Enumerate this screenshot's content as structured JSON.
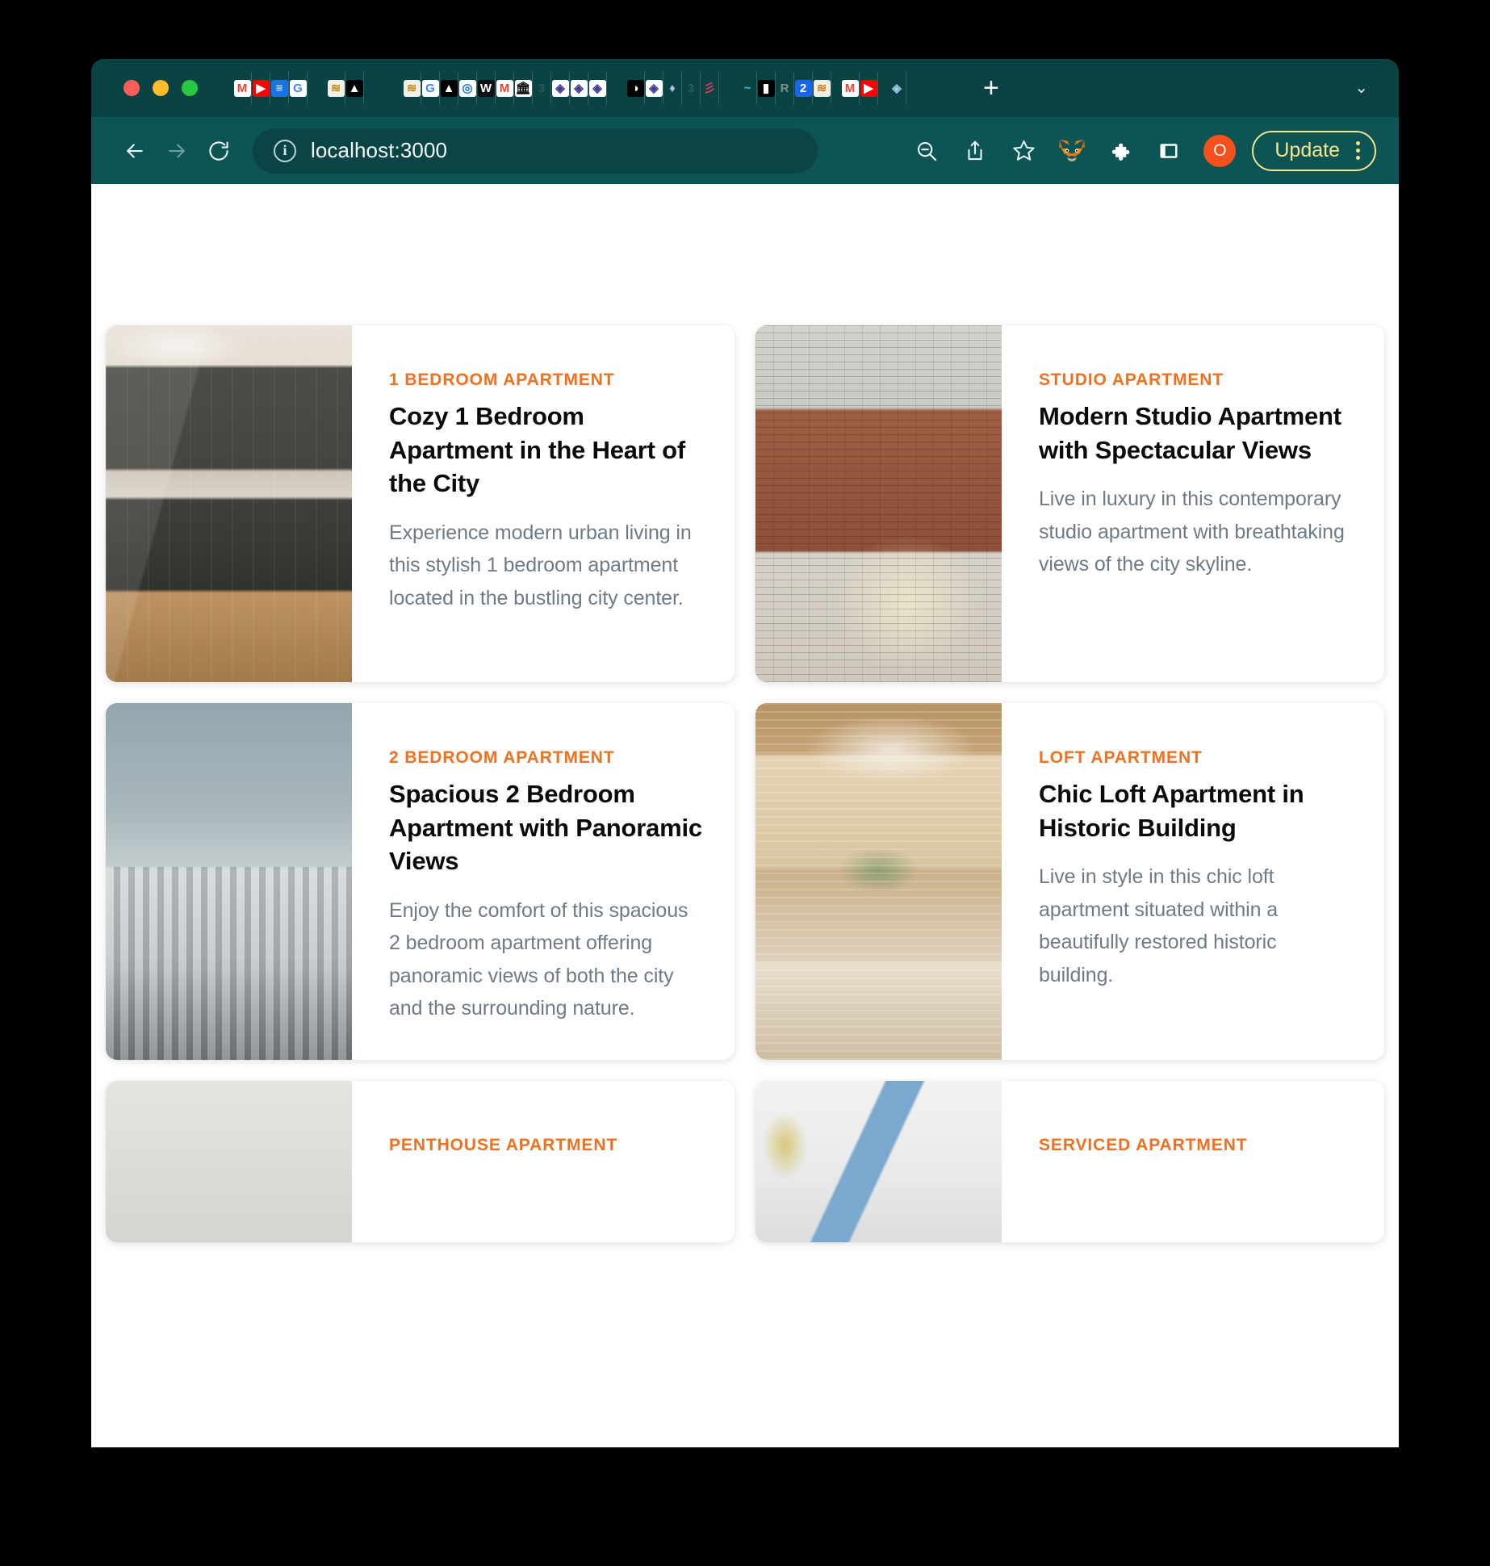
{
  "browser": {
    "traffic_lights": [
      "close",
      "minimize",
      "maximize"
    ],
    "new_tab_label": "+",
    "tab_list_chevron": "⌄",
    "nav": {
      "back_label": "←",
      "forward_label": "→",
      "reload_label": "⟳",
      "url": "localhost:3000",
      "info_glyph": "i"
    },
    "toolbar": {
      "zoom_out_icon": "zoom-out-icon",
      "share_icon": "share-icon",
      "bookmark_icon": "star-icon",
      "metamask_icon": "metamask-fox-icon",
      "extensions_icon": "puzzle-piece-icon",
      "sidebar_icon": "sidebar-panel-icon",
      "profile_initial": "O",
      "update_label": "Update",
      "menu_icon": "kebab-menu-icon"
    },
    "tabs": [
      {
        "name": "gmail",
        "glyph": "M"
      },
      {
        "name": "youtube",
        "glyph": "▶"
      },
      {
        "name": "google-docs",
        "glyph": "≡"
      },
      {
        "name": "google",
        "glyph": "G"
      },
      {
        "name": "blank-1",
        "glyph": ""
      },
      {
        "name": "blank-2",
        "glyph": ""
      },
      {
        "name": "sui",
        "glyph": "≋"
      },
      {
        "name": "vercel",
        "glyph": "▲"
      },
      {
        "name": "blank-3",
        "glyph": ""
      },
      {
        "name": "blank-4",
        "glyph": ""
      },
      {
        "name": "blank-5",
        "glyph": ""
      },
      {
        "name": "blank-6",
        "glyph": ""
      },
      {
        "name": "sui-2",
        "glyph": "≋"
      },
      {
        "name": "google-2",
        "glyph": "G"
      },
      {
        "name": "vercel-2",
        "glyph": "▲"
      },
      {
        "name": "chrome",
        "glyph": "◎"
      },
      {
        "name": "wikipedia",
        "glyph": "W"
      },
      {
        "name": "gmail-2",
        "glyph": "M"
      },
      {
        "name": "bank",
        "glyph": "🏛"
      },
      {
        "name": "web3-1",
        "glyph": "3"
      },
      {
        "name": "ethereum-1",
        "glyph": "◈"
      },
      {
        "name": "ethereum-2",
        "glyph": "◈"
      },
      {
        "name": "ethereum-3",
        "glyph": "◈"
      },
      {
        "name": "blank-7",
        "glyph": ""
      },
      {
        "name": "blank-8",
        "glyph": ""
      },
      {
        "name": "moon",
        "glyph": "◑"
      },
      {
        "name": "ethereum-4",
        "glyph": "◈"
      },
      {
        "name": "ethereum-diamond",
        "glyph": "♦"
      },
      {
        "name": "web3-2",
        "glyph": "3"
      },
      {
        "name": "sei",
        "glyph": "彡"
      },
      {
        "name": "blank-9",
        "glyph": ""
      },
      {
        "name": "blank-10",
        "glyph": ""
      },
      {
        "name": "coinbase",
        "glyph": "~"
      },
      {
        "name": "dark-square",
        "glyph": "▮"
      },
      {
        "name": "r-logo",
        "glyph": "R"
      },
      {
        "name": "two-logo",
        "glyph": "2"
      },
      {
        "name": "sui-3",
        "glyph": "≋"
      },
      {
        "name": "blank-11",
        "glyph": ""
      },
      {
        "name": "gmail-3",
        "glyph": "M"
      },
      {
        "name": "youtube-2",
        "glyph": "▶"
      },
      {
        "name": "blank-12",
        "glyph": ""
      },
      {
        "name": "ethereum-5",
        "glyph": "◈"
      }
    ]
  },
  "listings": [
    {
      "kicker": "1 BEDROOM APARTMENT",
      "title": "Cozy 1 Bedroom Apartment in the Heart of the City",
      "description": "Experience modern urban living in this stylish 1 bedroom apartment located in the bustling city center.",
      "image_name": "modern-kitchen-photo"
    },
    {
      "kicker": "STUDIO APARTMENT",
      "title": "Modern Studio Apartment with Spectacular Views",
      "description": "Live in luxury in this contemporary studio apartment with breathtaking views of the city skyline.",
      "image_name": "brick-loft-interior-photo"
    },
    {
      "kicker": "2 BEDROOM APARTMENT",
      "title": "Spacious 2 Bedroom Apartment with Panoramic Views",
      "description": "Enjoy the comfort of this spacious 2 bedroom apartment offering panoramic views of both the city and the surrounding nature.",
      "image_name": "apartment-building-exterior-photo"
    },
    {
      "kicker": "LOFT APARTMENT",
      "title": "Chic Loft Apartment in Historic Building",
      "description": "Live in style in this chic loft apartment situated within a beautifully restored historic building.",
      "image_name": "loft-dining-room-photo"
    },
    {
      "kicker": "PENTHOUSE APARTMENT",
      "title": "",
      "description": "",
      "image_name": "penthouse-photo"
    },
    {
      "kicker": "SERVICED APARTMENT",
      "title": "",
      "description": "",
      "image_name": "serviced-apartment-photo"
    }
  ],
  "colors": {
    "browser_chrome": "#0b4a4a",
    "nav_bar": "#0d5454",
    "accent_orange": "#f07020",
    "update_yellow": "#f6e58d",
    "profile_orange": "#f4511e",
    "title_black": "#0a0a0a",
    "body_gray": "#6d7b87"
  }
}
